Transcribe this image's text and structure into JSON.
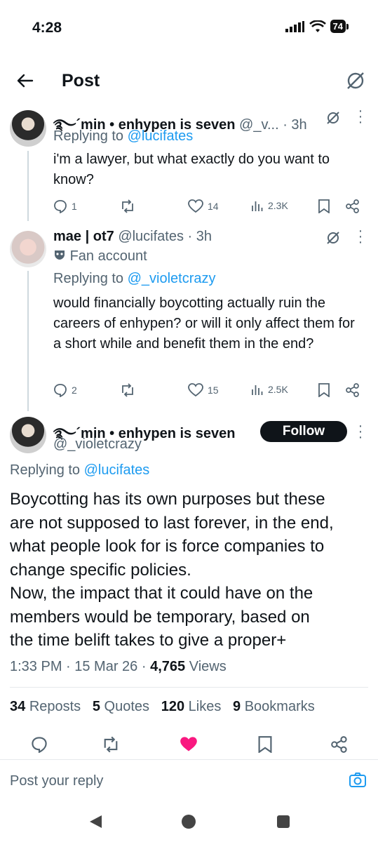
{
  "status_bar": {
    "time": "4:28",
    "battery": "74"
  },
  "header": {
    "title": "Post"
  },
  "tweets": [
    {
      "display_name": "࿐´min • enhypen is seven",
      "handle": "@_v...",
      "time": "· 3h",
      "replying_to_prefix": "Replying to",
      "replying_to": "@lucifates",
      "text": "i'm a lawyer, but what exactly do you want to know?",
      "replies": "1",
      "likes": "14",
      "views": "2.3K"
    },
    {
      "display_name": "mae | ot7",
      "handle": "@lucifates",
      "time": "· 3h",
      "label": "Fan account",
      "replying_to_prefix": "Replying to",
      "replying_to": "@_violetcrazy",
      "text": "would financially boycotting actually ruin the careers of enhypen? or will it only affect them for a short while and benefit them in the end?",
      "replies": "2",
      "likes": "15",
      "views": "2.5K"
    }
  ],
  "main_post": {
    "display_name": "࿐´min • enhypen is seven",
    "handle": "@_violetcrazy",
    "follow_label": "Follow",
    "replying_to_prefix": "Replying to",
    "replying_to": "@lucifates",
    "text_line1": "Boycotting has its own purposes but these",
    "text_line2": "are not supposed to last forever, in the end,",
    "text_line3": "what people look for is force companies to",
    "text_line4": "change specific policies.",
    "text_line5": "Now, the impact that it could have on the",
    "text_line6": "members would be temporary, based on",
    "text_line7": "the time belift takes to give a proper+",
    "timestamp": "1:33 PM · 15 Mar 26 ·",
    "views_count": "4,765",
    "views_label": "Views",
    "reposts_count": "34",
    "reposts_label": "Reposts",
    "quotes_count": "5",
    "quotes_label": "Quotes",
    "likes_count": "120",
    "likes_label": "Likes",
    "bookmarks_count": "9",
    "bookmarks_label": "Bookmarks"
  },
  "reply_bar": {
    "placeholder": "Post your reply"
  },
  "colors": {
    "accent": "#1d9bf0",
    "like": "#f91880",
    "text": "#0f1419",
    "muted": "#536471"
  }
}
